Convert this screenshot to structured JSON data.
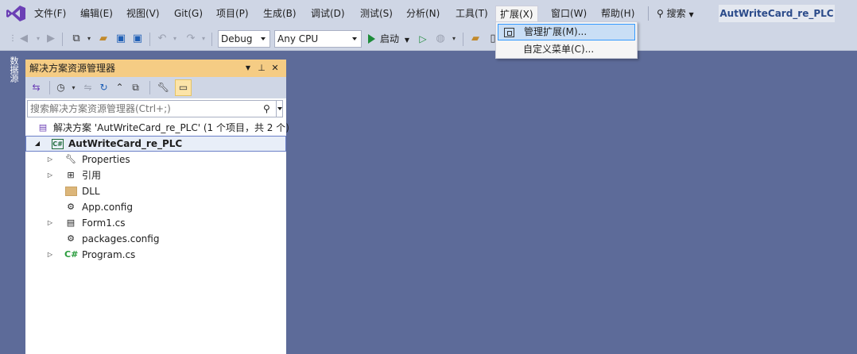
{
  "menubar": {
    "items": [
      "文件(F)",
      "编辑(E)",
      "视图(V)",
      "Git(G)",
      "项目(P)",
      "生成(B)",
      "调试(D)",
      "测试(S)",
      "分析(N)",
      "工具(T)",
      "扩展(X)",
      "窗口(W)",
      "帮助(H)"
    ],
    "search_label": "搜索",
    "solution_title": "AutWriteCard_re_PLC"
  },
  "toolbar": {
    "config": "Debug",
    "platform": "Any CPU",
    "start_label": "启动"
  },
  "extensions_menu": {
    "items": [
      "管理扩展(M)...",
      "自定义菜单(C)..."
    ]
  },
  "side_tab": {
    "label": "数据源"
  },
  "solution_explorer": {
    "title": "解决方案资源管理器",
    "search_placeholder": "搜索解决方案资源管理器(Ctrl+;)",
    "solution_node": "解决方案 'AutWriteCard_re_PLC' (1 个项目，共 2 个)",
    "project_node": "AutWriteCard_re_PLC",
    "children": [
      "Properties",
      "引用",
      "DLL",
      "App.config",
      "Form1.cs",
      "packages.config",
      "Program.cs"
    ]
  },
  "colors": {
    "background": "#5d6b99",
    "panel_title": "#f5cc84",
    "menu_highlight": "#c9def5",
    "start_green": "#1d8b3a"
  }
}
